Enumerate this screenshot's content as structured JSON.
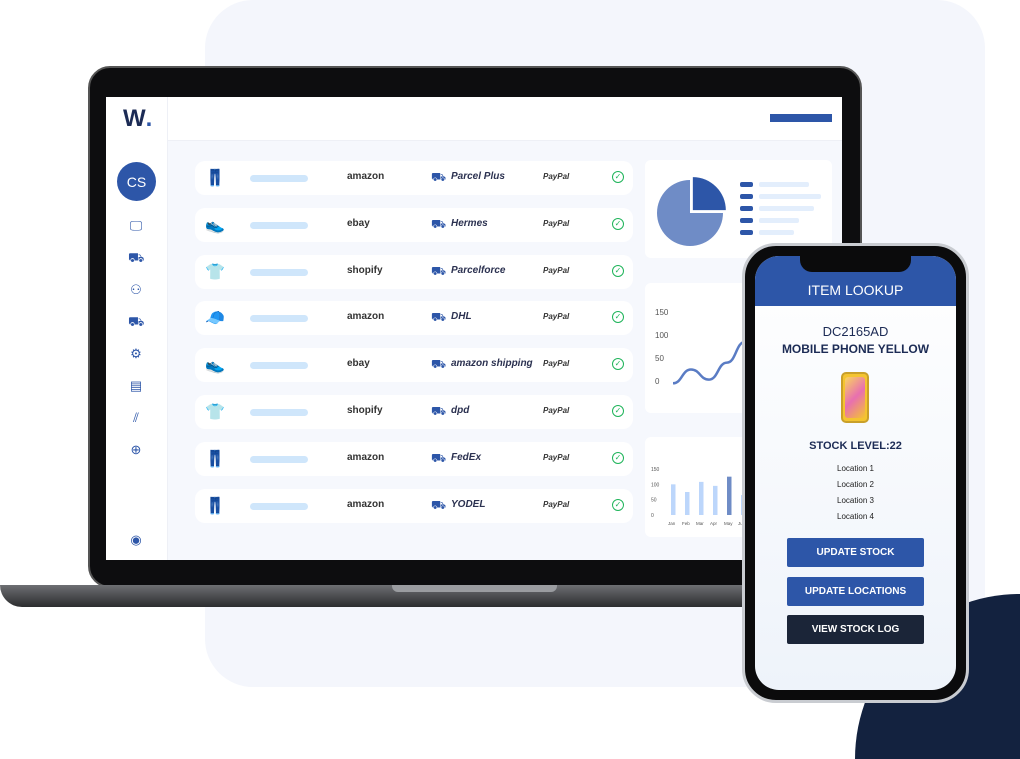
{
  "app": {
    "logo": "W",
    "logo_dot": ".",
    "avatar_initials": "CS"
  },
  "sidebar": {
    "icons": [
      "monitor-icon",
      "truck-icon",
      "users-icon",
      "delivery-icon",
      "team-settings-icon",
      "book-icon",
      "chart-icon",
      "globe-icon"
    ],
    "glyphs": [
      "🖵",
      "⛟",
      "⚇",
      "⛟",
      "⚙",
      "▤",
      "⫽",
      "⊕"
    ],
    "bottom_icon": "user-circle-icon"
  },
  "orders": [
    {
      "product": "trousers",
      "glyph": "👖",
      "marketplace": "amazon",
      "carrier": "Parcel Plus",
      "payment": "PayPal",
      "status": "complete"
    },
    {
      "product": "shoe",
      "glyph": "👟",
      "marketplace": "ebay",
      "carrier": "Hermes",
      "payment": "PayPal",
      "status": "complete"
    },
    {
      "product": "t-shirt",
      "glyph": "👕",
      "marketplace": "shopify",
      "carrier": "Parcelforce",
      "payment": "PayPal",
      "status": "complete"
    },
    {
      "product": "cap",
      "glyph": "🧢",
      "marketplace": "amazon",
      "carrier": "DHL",
      "payment": "PayPal",
      "status": "complete"
    },
    {
      "product": "sneaker",
      "glyph": "👟",
      "marketplace": "ebay",
      "carrier": "amazon shipping",
      "payment": "PayPal",
      "status": "complete"
    },
    {
      "product": "t-shirt",
      "glyph": "👕",
      "marketplace": "shopify",
      "carrier": "dpd",
      "payment": "PayPal",
      "status": "complete"
    },
    {
      "product": "trousers",
      "glyph": "👖",
      "marketplace": "amazon",
      "carrier": "FedEx",
      "payment": "PayPal",
      "status": "complete"
    },
    {
      "product": "trousers",
      "glyph": "👖",
      "marketplace": "amazon",
      "carrier": "YODEL",
      "payment": "PayPal",
      "status": "complete"
    }
  ],
  "charts": {
    "pie": {
      "type": "pie",
      "values": [
        25,
        75
      ],
      "colors": [
        "#2d56a8",
        "#6f8cc6"
      ],
      "legend_items": 5
    },
    "line": {
      "type": "line",
      "yticks": [
        "150",
        "100",
        "50",
        "0"
      ],
      "ylim": [
        0,
        150
      ],
      "values": [
        -5,
        25,
        3,
        40,
        85,
        130
      ],
      "color": "#5a7cc4"
    },
    "bar": {
      "type": "bar",
      "categories": [
        "Jan",
        "Feb",
        "Mar",
        "Apr",
        "May",
        "Jun"
      ],
      "values": [
        100,
        75,
        108,
        95,
        125,
        65
      ],
      "yticks": [
        "150",
        "100",
        "50",
        "0"
      ],
      "ylim": [
        0,
        150
      ],
      "highlight": "May",
      "colors": {
        "normal": "#bcd6fb",
        "highlight": "#6f8cc6"
      }
    }
  },
  "phone": {
    "title": "ITEM LOOKUP",
    "sku": "DC2165AD",
    "product_name": "MOBILE PHONE YELLOW",
    "stock_level": "STOCK LEVEL:22",
    "locations": [
      "Location 1",
      "Location 2",
      "Location 3",
      "Location 4"
    ],
    "buttons": {
      "update_stock": "UPDATE STOCK",
      "update_locations": "UPDATE LOCATIONS",
      "view_log": "VIEW STOCK LOG"
    }
  },
  "colors": {
    "brand": "#2d56a8",
    "navy": "#13223f",
    "success": "#1fb45a"
  }
}
